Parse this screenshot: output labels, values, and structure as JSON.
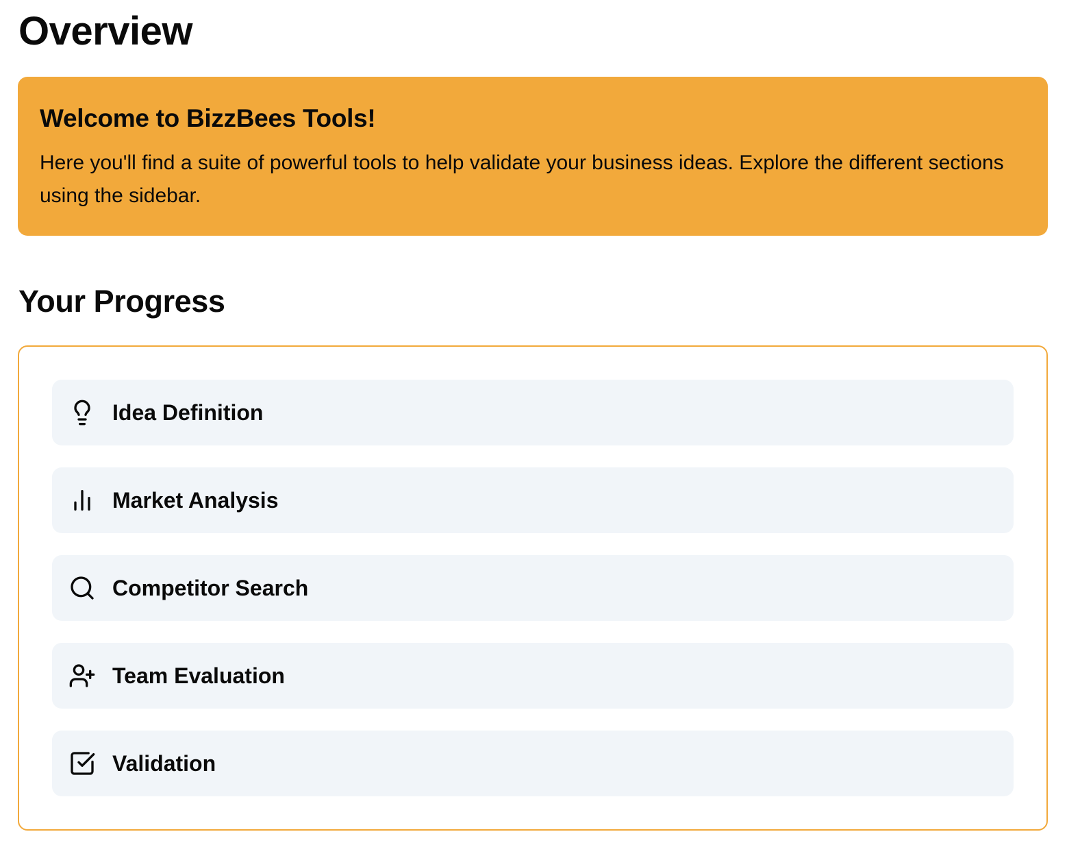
{
  "page": {
    "title": "Overview"
  },
  "welcome": {
    "title": "Welcome to BizzBees Tools!",
    "text": "Here you'll find a suite of powerful tools to help validate your business ideas. Explore the different sections using the sidebar.",
    "background_color": "#f2a93b"
  },
  "progress": {
    "title": "Your Progress",
    "border_color": "#f2a93b",
    "item_background": "#f1f5f9",
    "items": [
      {
        "label": "Idea Definition",
        "icon": "lightbulb-icon"
      },
      {
        "label": "Market Analysis",
        "icon": "bar-chart-icon"
      },
      {
        "label": "Competitor Search",
        "icon": "search-icon"
      },
      {
        "label": "Team Evaluation",
        "icon": "user-plus-icon"
      },
      {
        "label": "Validation",
        "icon": "checkbox-icon"
      }
    ]
  }
}
